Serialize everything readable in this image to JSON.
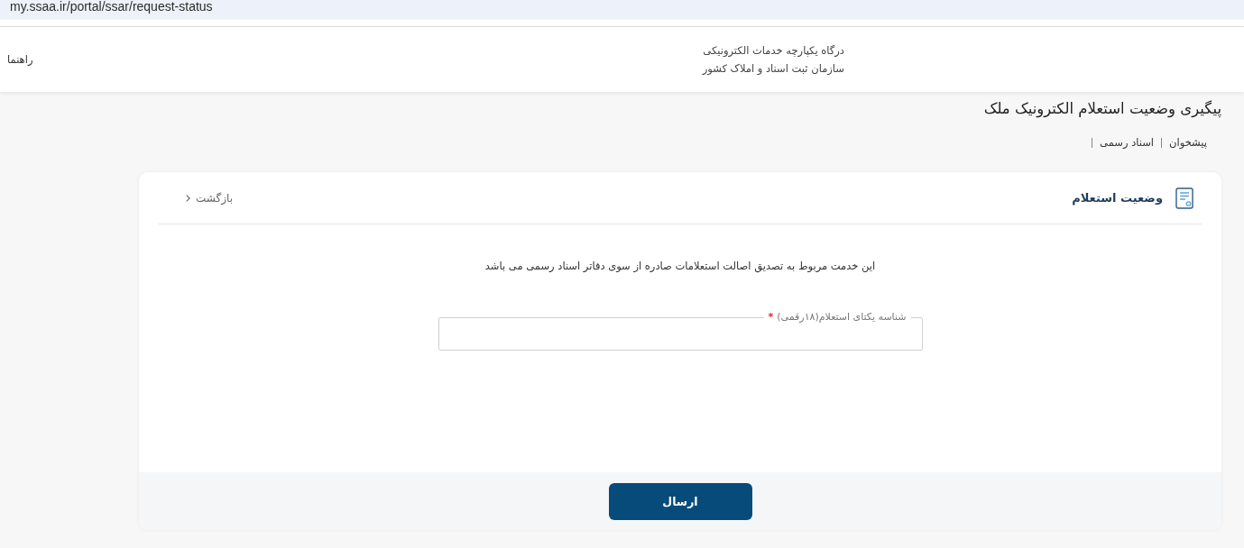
{
  "browser": {
    "url": "my.ssaa.ir/portal/ssar/request-status"
  },
  "header": {
    "help_link": "راهنما",
    "portal_name": "درگاه یکپارچه خدمات الکترونیکی",
    "organization": "سازمان ثبت اسناد و املاک کشور"
  },
  "page": {
    "title": "پیگیری وضعیت استعلام الکترونیک ملک",
    "breadcrumb": [
      "پیشخوان",
      "اسناد رسمی"
    ]
  },
  "card": {
    "title": "وضعیت استعلام",
    "back_link": "بازگشت",
    "description": "این خدمت مربوط به تصدیق اصالت استعلامات صادره از سوی دفاتر اسناد رسمی می باشد",
    "field": {
      "label": "شناسه یکتای استعلام(۱۸رقمی)",
      "required_mark": "*"
    },
    "submit_button": "ارسال"
  }
}
